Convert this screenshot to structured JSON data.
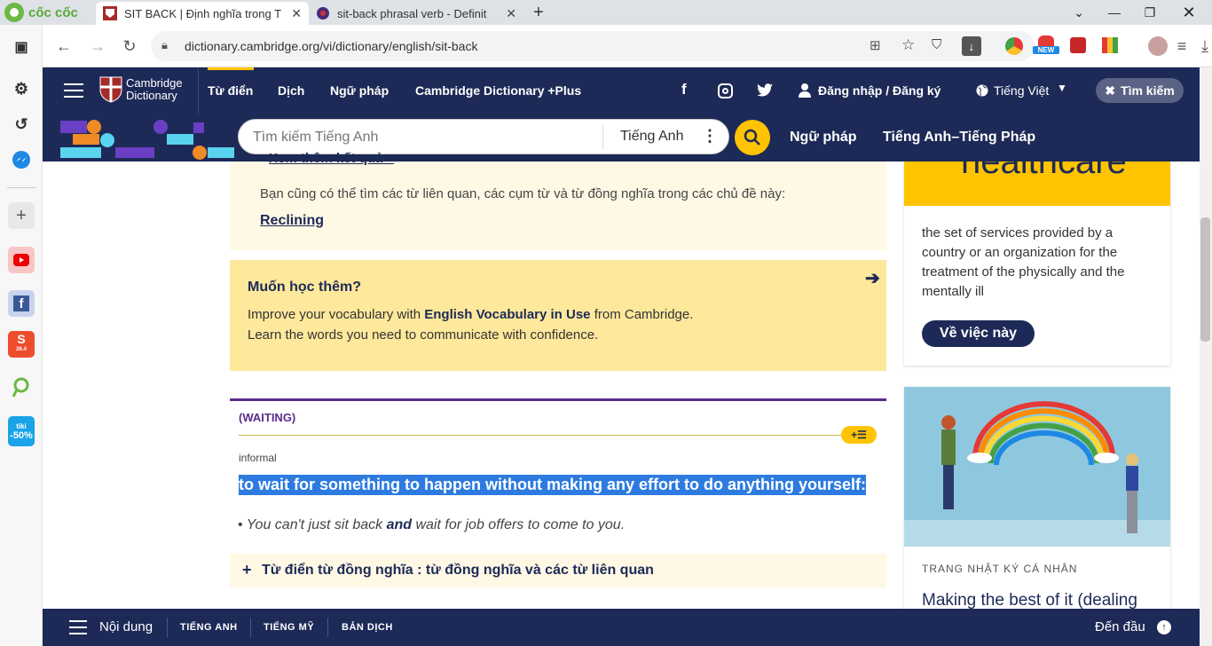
{
  "browser": {
    "brand": "cốc cốc",
    "tabs": [
      {
        "title": "SIT BACK | Định nghĩa trong T"
      },
      {
        "title": "sit-back phrasal verb - Definit"
      }
    ],
    "url": "dictionary.cambridge.org/vi/dictionary/english/sit-back",
    "new_badge": "NEW",
    "sidebar_badges": {
      "shopee": "26.4",
      "tiki_brand": "tiki",
      "tiki_discount": "-50%"
    }
  },
  "nav": {
    "logo_line1": "Cambridge",
    "logo_line2": "Dictionary",
    "links": [
      "Từ điển",
      "Dịch",
      "Ngữ pháp",
      "Cambridge Dictionary +Plus"
    ],
    "login": "Đăng nhập / Đăng ký",
    "language": "Tiếng Việt",
    "close_search": "Tìm kiếm",
    "search_placeholder": "Tìm kiếm Tiếng Anh",
    "search_lang": "Tiếng Anh",
    "sub_links": [
      "Ngữ pháp",
      "Tiếng Anh–Tiếng Pháp"
    ]
  },
  "content": {
    "see_more_partial": "Xem thêm kết quả »",
    "related_text": "Bạn cũng có thể tìm các từ liên quan, các cụm từ và từ đồng nghĩa trong các chủ đề này:",
    "related_link": "Reclining",
    "learn_title": "Muốn học thêm?",
    "learn_line1_pre": "Improve your vocabulary with ",
    "learn_line1_bold": "English Vocabulary in Use",
    "learn_line1_post": " from Cambridge.",
    "learn_line2": "Learn the words you need to communicate with confidence.",
    "sense_label": "(WAITING)",
    "register": "informal",
    "definition": "to wait for something to happen without making any effort to do anything yourself:",
    "example_pre": "You can't just sit back ",
    "example_bold": "and",
    "example_post": " wait for job offers to come to you.",
    "synonyms": "Từ điển từ đồng nghĩa : từ đồng nghĩa và các từ liên quan"
  },
  "right": {
    "word_partial": "healthcare",
    "definition": "the set of services provided by a country or an organization for the treatment of the physically and the mentally ill",
    "button": "Về việc này",
    "blog_category": "TRANG NHẬT KÝ CÁ NHÂN",
    "blog_title": "Making the best of it (dealing"
  },
  "bottom": {
    "menu": "Nội dung",
    "items": [
      "TIẾNG ANH",
      "TIẾNG MỸ",
      "BẢN DỊCH"
    ],
    "top": "Đến đầu"
  },
  "colors": {
    "navy": "#1d2a57",
    "yellow": "#ffc400",
    "cream": "#fff8e5",
    "highlight": "#2d7be0",
    "purple": "#5b2c8c"
  }
}
